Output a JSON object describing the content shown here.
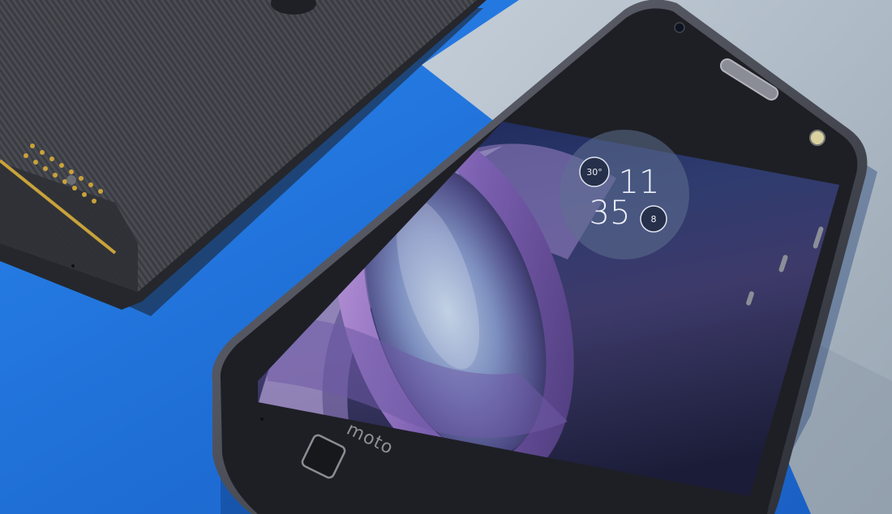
{
  "watch": {
    "hour": "11",
    "minute": "35",
    "temperature": "30°",
    "notification_count": "8"
  },
  "phone": {
    "brand": "moto"
  },
  "colors": {
    "background_blue": "#1f6fd6",
    "paper_gray": "#aab6c1",
    "phone_body": "#2b2d33",
    "screen_top": "#16204a",
    "lens_purple": "#7b5fb0",
    "contact_gold": "#c9a23a"
  }
}
